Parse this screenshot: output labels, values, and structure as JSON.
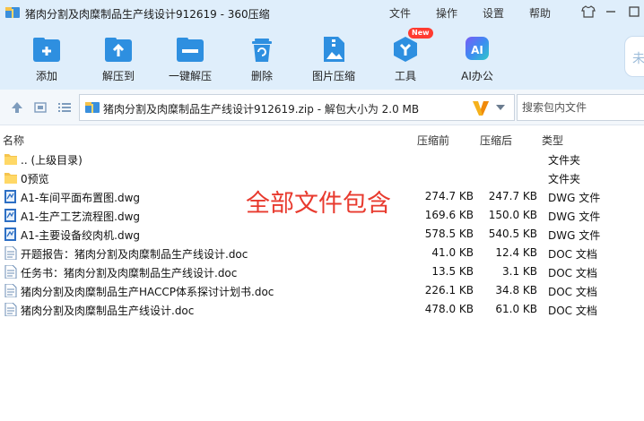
{
  "window": {
    "title": "猪肉分割及肉糜制品生产线设计912619 - 360压缩"
  },
  "menu": {
    "file": "文件",
    "operate": "操作",
    "settings": "设置",
    "help": "帮助"
  },
  "toolbar": {
    "add": "添加",
    "extract_to": "解压到",
    "one_click_extract": "一键解压",
    "delete": "删除",
    "image_compress": "图片压缩",
    "tools": "工具",
    "tools_badge": "New",
    "ai_office": "AI办公",
    "ai_icon_text": "AI",
    "side_tab_text": "未"
  },
  "address": {
    "path": "猪肉分割及肉糜制品生产线设计912619.zip - 解包大小为 2.0 MB",
    "search_placeholder": "搜索包内文件"
  },
  "columns": {
    "name": "名称",
    "compressed": "压缩前",
    "uncompressed": "压缩后",
    "type": "类型"
  },
  "files": [
    {
      "name": ".. (上级目录)",
      "before": "",
      "after": "",
      "type": "文件夹",
      "icon": "folder-icon"
    },
    {
      "name": "0预览",
      "before": "",
      "after": "",
      "type": "文件夹",
      "icon": "folder-icon"
    },
    {
      "name": "A1-车间平面布置图.dwg",
      "before": "274.7 KB",
      "after": "247.7 KB",
      "type": "DWG 文件",
      "icon": "dwg-file-icon"
    },
    {
      "name": "A1-生产工艺流程图.dwg",
      "before": "169.6 KB",
      "after": "150.0 KB",
      "type": "DWG 文件",
      "icon": "dwg-file-icon"
    },
    {
      "name": "A1-主要设备绞肉机.dwg",
      "before": "578.5 KB",
      "after": "540.5 KB",
      "type": "DWG 文件",
      "icon": "dwg-file-icon"
    },
    {
      "name": "开题报告：猪肉分割及肉糜制品生产线设计.doc",
      "before": "41.0 KB",
      "after": "12.4 KB",
      "type": "DOC 文档",
      "icon": "doc-file-icon"
    },
    {
      "name": "任务书：猪肉分割及肉糜制品生产线设计.doc",
      "before": "13.5 KB",
      "after": "3.1 KB",
      "type": "DOC 文档",
      "icon": "doc-file-icon"
    },
    {
      "name": "猪肉分割及肉糜制品生产HACCP体系探讨计划书.doc",
      "before": "226.1 KB",
      "after": "34.8 KB",
      "type": "DOC 文档",
      "icon": "doc-file-icon"
    },
    {
      "name": "猪肉分割及肉糜制品生产线设计.doc",
      "before": "478.0 KB",
      "after": "61.0 KB",
      "type": "DOC 文档",
      "icon": "doc-file-icon"
    }
  ],
  "overlay": {
    "text": "全部文件包含"
  },
  "colors": {
    "accent": "#2e8fe0",
    "overlay_red": "#e83a2e",
    "folder": "#f5c44e"
  }
}
